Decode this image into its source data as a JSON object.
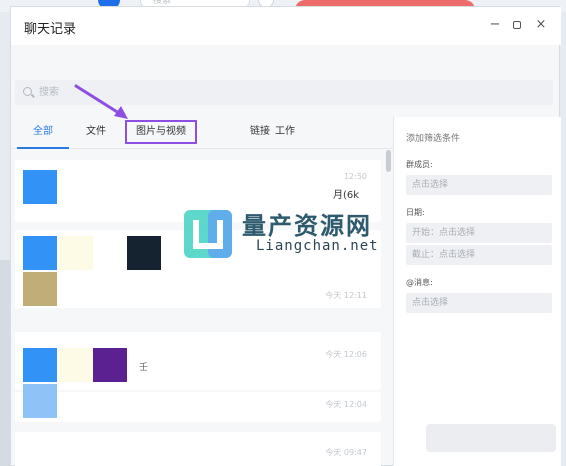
{
  "background": {
    "search_placeholder": "搜索"
  },
  "window": {
    "title": "聊天记录",
    "minimize": "−",
    "close": "×"
  },
  "search": {
    "placeholder": "搜索"
  },
  "tabs": [
    {
      "label": "全部",
      "active": true
    },
    {
      "label": "文件",
      "active": false
    },
    {
      "label": "图片与视频",
      "active": false,
      "highlighted": true
    },
    {
      "label": "链接",
      "active": false
    },
    {
      "label": "工作",
      "active": false
    }
  ],
  "messages": [
    {
      "time": "12:50",
      "filename": "月(6k"
    },
    {
      "time": ""
    },
    {
      "time": "今天 12:11"
    },
    {
      "time": "今天 12:06",
      "char": "壬"
    },
    {
      "time": "今天 12:04"
    },
    {
      "time": "今天 09:47"
    }
  ],
  "filter": {
    "title": "添加筛选条件",
    "member_label": "群成员:",
    "member_placeholder": "点击选择",
    "date_label": "日期:",
    "start_placeholder": "开始：点击选择",
    "end_placeholder": "截止：点击选择",
    "mention_label": "@消息:",
    "mention_placeholder": "点击选择"
  },
  "watermark": {
    "cn": "量产资源网",
    "en": "Liangchan.net"
  },
  "colors": {
    "accent": "#2b79e0",
    "highlight": "#8f4ee2",
    "thumb_blue": "#3392f5",
    "thumb_tan": "#c1ad78",
    "thumb_navy": "#152330",
    "thumb_purple": "#5b2190",
    "thumb_cream": "#fdfbe6"
  }
}
